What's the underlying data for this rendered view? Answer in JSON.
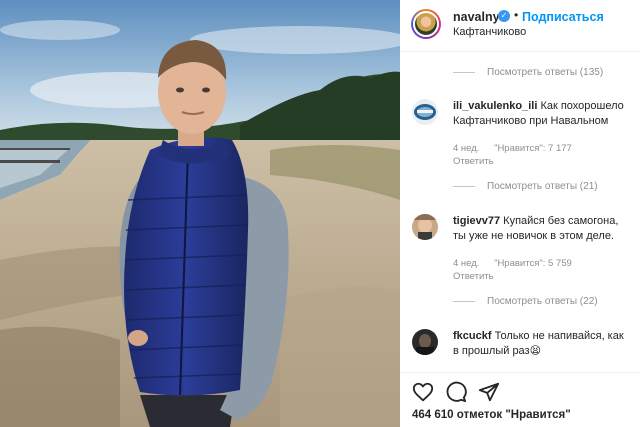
{
  "post": {
    "username": "navalny",
    "follow_label": "Подписаться",
    "location": "Кафтанчиково"
  },
  "comments": [
    {
      "view_replies": "Посмотреть ответы (135)"
    },
    {
      "username": "ili_vakulenko_ili",
      "text": "Как похорошело Кафтанчиково при Навальном",
      "time": "4 нед.",
      "likes": "\"Нравится\": 7 177",
      "reply": "Ответить",
      "view_replies": "Посмотреть ответы (21)"
    },
    {
      "username": "tigievv77",
      "text": "Купайся без самогона, ты уже не новичок в этом деле.",
      "time": "4 нед.",
      "likes": "\"Нравится\": 5 759",
      "reply": "Ответить",
      "view_replies": "Посмотреть ответы (22)"
    },
    {
      "username": "fkcuckf",
      "text": "Только не напивайся, как в прошлый раз😫"
    }
  ],
  "actions": {
    "likes_count": "464 610 отметок \"Нравится\""
  },
  "icons": {
    "verified": "verified-badge-icon",
    "like": "heart-icon",
    "comment": "comment-bubble-icon",
    "share": "paper-plane-icon"
  },
  "colors": {
    "accent": "#0095f6",
    "secondary_text": "#8e8e8e",
    "text": "#262626"
  }
}
